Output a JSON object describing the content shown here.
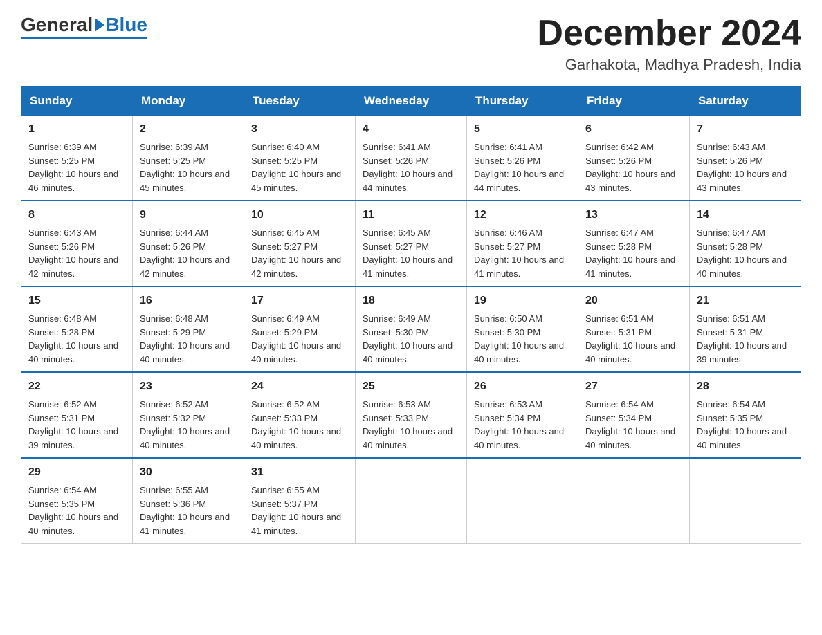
{
  "header": {
    "logo_general": "General",
    "logo_blue": "Blue",
    "month_title": "December 2024",
    "location": "Garhakota, Madhya Pradesh, India"
  },
  "weekdays": [
    "Sunday",
    "Monday",
    "Tuesday",
    "Wednesday",
    "Thursday",
    "Friday",
    "Saturday"
  ],
  "weeks": [
    [
      {
        "day": "1",
        "sunrise": "6:39 AM",
        "sunset": "5:25 PM",
        "daylight": "10 hours and 46 minutes."
      },
      {
        "day": "2",
        "sunrise": "6:39 AM",
        "sunset": "5:25 PM",
        "daylight": "10 hours and 45 minutes."
      },
      {
        "day": "3",
        "sunrise": "6:40 AM",
        "sunset": "5:25 PM",
        "daylight": "10 hours and 45 minutes."
      },
      {
        "day": "4",
        "sunrise": "6:41 AM",
        "sunset": "5:26 PM",
        "daylight": "10 hours and 44 minutes."
      },
      {
        "day": "5",
        "sunrise": "6:41 AM",
        "sunset": "5:26 PM",
        "daylight": "10 hours and 44 minutes."
      },
      {
        "day": "6",
        "sunrise": "6:42 AM",
        "sunset": "5:26 PM",
        "daylight": "10 hours and 43 minutes."
      },
      {
        "day": "7",
        "sunrise": "6:43 AM",
        "sunset": "5:26 PM",
        "daylight": "10 hours and 43 minutes."
      }
    ],
    [
      {
        "day": "8",
        "sunrise": "6:43 AM",
        "sunset": "5:26 PM",
        "daylight": "10 hours and 42 minutes."
      },
      {
        "day": "9",
        "sunrise": "6:44 AM",
        "sunset": "5:26 PM",
        "daylight": "10 hours and 42 minutes."
      },
      {
        "day": "10",
        "sunrise": "6:45 AM",
        "sunset": "5:27 PM",
        "daylight": "10 hours and 42 minutes."
      },
      {
        "day": "11",
        "sunrise": "6:45 AM",
        "sunset": "5:27 PM",
        "daylight": "10 hours and 41 minutes."
      },
      {
        "day": "12",
        "sunrise": "6:46 AM",
        "sunset": "5:27 PM",
        "daylight": "10 hours and 41 minutes."
      },
      {
        "day": "13",
        "sunrise": "6:47 AM",
        "sunset": "5:28 PM",
        "daylight": "10 hours and 41 minutes."
      },
      {
        "day": "14",
        "sunrise": "6:47 AM",
        "sunset": "5:28 PM",
        "daylight": "10 hours and 40 minutes."
      }
    ],
    [
      {
        "day": "15",
        "sunrise": "6:48 AM",
        "sunset": "5:28 PM",
        "daylight": "10 hours and 40 minutes."
      },
      {
        "day": "16",
        "sunrise": "6:48 AM",
        "sunset": "5:29 PM",
        "daylight": "10 hours and 40 minutes."
      },
      {
        "day": "17",
        "sunrise": "6:49 AM",
        "sunset": "5:29 PM",
        "daylight": "10 hours and 40 minutes."
      },
      {
        "day": "18",
        "sunrise": "6:49 AM",
        "sunset": "5:30 PM",
        "daylight": "10 hours and 40 minutes."
      },
      {
        "day": "19",
        "sunrise": "6:50 AM",
        "sunset": "5:30 PM",
        "daylight": "10 hours and 40 minutes."
      },
      {
        "day": "20",
        "sunrise": "6:51 AM",
        "sunset": "5:31 PM",
        "daylight": "10 hours and 40 minutes."
      },
      {
        "day": "21",
        "sunrise": "6:51 AM",
        "sunset": "5:31 PM",
        "daylight": "10 hours and 39 minutes."
      }
    ],
    [
      {
        "day": "22",
        "sunrise": "6:52 AM",
        "sunset": "5:31 PM",
        "daylight": "10 hours and 39 minutes."
      },
      {
        "day": "23",
        "sunrise": "6:52 AM",
        "sunset": "5:32 PM",
        "daylight": "10 hours and 40 minutes."
      },
      {
        "day": "24",
        "sunrise": "6:52 AM",
        "sunset": "5:33 PM",
        "daylight": "10 hours and 40 minutes."
      },
      {
        "day": "25",
        "sunrise": "6:53 AM",
        "sunset": "5:33 PM",
        "daylight": "10 hours and 40 minutes."
      },
      {
        "day": "26",
        "sunrise": "6:53 AM",
        "sunset": "5:34 PM",
        "daylight": "10 hours and 40 minutes."
      },
      {
        "day": "27",
        "sunrise": "6:54 AM",
        "sunset": "5:34 PM",
        "daylight": "10 hours and 40 minutes."
      },
      {
        "day": "28",
        "sunrise": "6:54 AM",
        "sunset": "5:35 PM",
        "daylight": "10 hours and 40 minutes."
      }
    ],
    [
      {
        "day": "29",
        "sunrise": "6:54 AM",
        "sunset": "5:35 PM",
        "daylight": "10 hours and 40 minutes."
      },
      {
        "day": "30",
        "sunrise": "6:55 AM",
        "sunset": "5:36 PM",
        "daylight": "10 hours and 41 minutes."
      },
      {
        "day": "31",
        "sunrise": "6:55 AM",
        "sunset": "5:37 PM",
        "daylight": "10 hours and 41 minutes."
      },
      null,
      null,
      null,
      null
    ]
  ],
  "cell_labels": {
    "sunrise": "Sunrise: ",
    "sunset": "Sunset: ",
    "daylight": "Daylight: "
  }
}
